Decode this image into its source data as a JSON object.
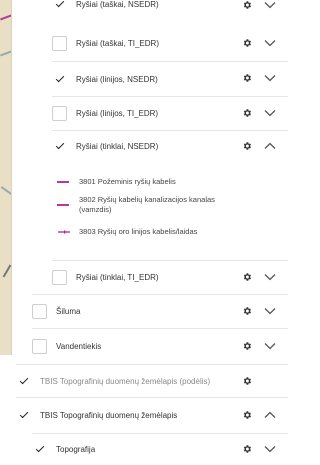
{
  "colors": {
    "accent": "#b53a9a",
    "text": "#333333",
    "muted": "#8a8a8a",
    "map_bg": "#e9dfc5"
  },
  "icons": {
    "settings": "gear-icon",
    "collapse": "chevron-down-icon",
    "expand": "chevron-up-icon",
    "check": "check-icon"
  },
  "layers": {
    "rysiai_taskai_nsedr": {
      "label": "Ryšiai (taškai, NSEDR)",
      "checked": true
    },
    "rysiai_taskai_ti_edr": {
      "label": "Ryšiai (taškai, TI_EDR)",
      "checked": false
    },
    "rysiai_linijos_nsedr": {
      "label": "Ryšiai (linijos, NSEDR)",
      "checked": true
    },
    "rysiai_linijos_ti_edr": {
      "label": "Ryšiai (linijos, TI_EDR)",
      "checked": false
    },
    "rysiai_tinklai_nsedr": {
      "label": "Ryšiai (tinklai, NSEDR)",
      "checked": true,
      "expanded": true
    },
    "rysiai_tinklai_ti_edr": {
      "label": "Ryšiai (tinklai, TI_EDR)",
      "checked": false
    },
    "siluma": {
      "label": "Šiluma",
      "checked": false
    },
    "vandentiekis": {
      "label": "Vandentiekis",
      "checked": false
    },
    "tbis_podelis": {
      "label": "TBIS Topografinių duomenų žemėlapis (podėlis)",
      "checked": true
    },
    "tbis_zemelapis": {
      "label": "TBIS Topografinių duomenų žemėlapis",
      "checked": true,
      "expanded": true
    },
    "topografija": {
      "label": "Topografija",
      "checked": true
    }
  },
  "legend": [
    {
      "label": "3801 Požeminis ryšių kabelis",
      "symbol": "line"
    },
    {
      "label": "3802 Ryšių kabelių kanalizacijos kanalas (vamzdis)",
      "symbol": "line"
    },
    {
      "label": "3803 Ryšių oro linijos kabelis/laidas",
      "symbol": "arrow-line"
    }
  ]
}
